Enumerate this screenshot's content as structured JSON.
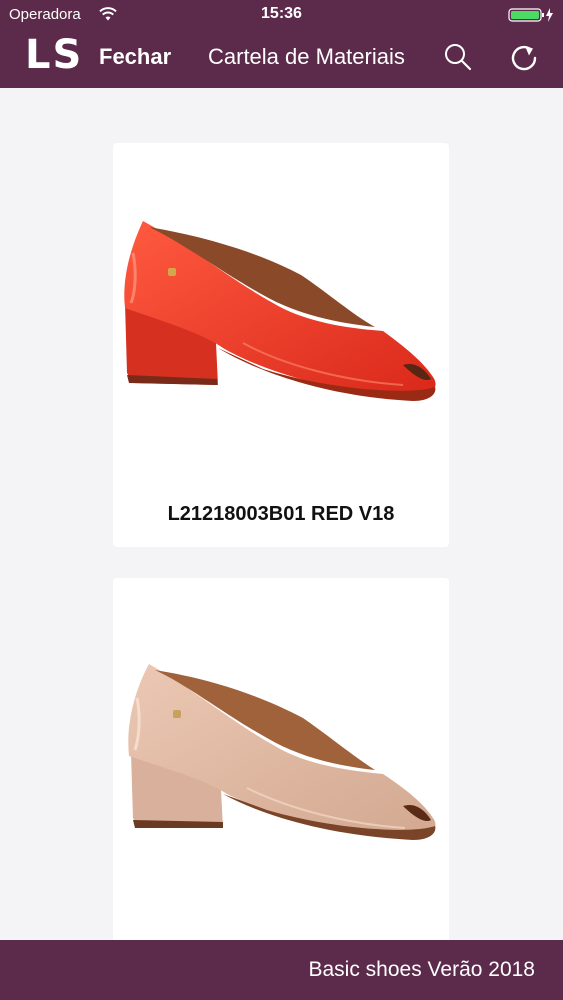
{
  "status_bar": {
    "carrier": "Operadora",
    "time": "15:36",
    "battery_color": "#4cd964"
  },
  "navbar": {
    "logo": "LS",
    "close_label": "Fechar",
    "title": "Cartela de Materiais",
    "search_icon": "search-icon",
    "refresh_icon": "refresh-icon"
  },
  "products": [
    {
      "code": "L21218003B01 RED V18",
      "color": "#e63a26"
    },
    {
      "code": "",
      "color": "#dcb6a0"
    }
  ],
  "footer": {
    "collection": "Basic shoes Verão 2018"
  },
  "colors": {
    "brand": "#5c2b4c",
    "background": "#f4f4f6"
  }
}
